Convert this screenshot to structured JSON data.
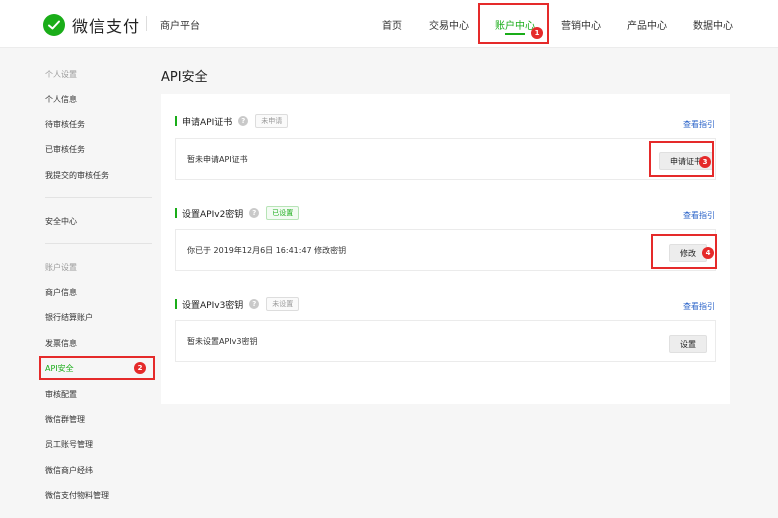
{
  "header": {
    "logo_text": "微信支付",
    "platform": "商户平台",
    "nav": [
      {
        "label": "首页"
      },
      {
        "label": "交易中心"
      },
      {
        "label": "账户中心"
      },
      {
        "label": "营销中心"
      },
      {
        "label": "产品中心"
      },
      {
        "label": "数据中心"
      }
    ],
    "active_nav_badge": "1"
  },
  "sidebar": {
    "group_personal": "个人设置",
    "personal_items": [
      {
        "label": "个人信息"
      },
      {
        "label": "待审核任务"
      },
      {
        "label": "已审核任务"
      },
      {
        "label": "我提交的审核任务"
      }
    ],
    "security_center": "安全中心",
    "group_account": "账户设置",
    "account_items": [
      {
        "label": "商户信息"
      },
      {
        "label": "银行结算账户"
      },
      {
        "label": "发票信息"
      },
      {
        "label": "API安全"
      },
      {
        "label": "审核配置"
      },
      {
        "label": "微信群管理"
      },
      {
        "label": "员工账号管理"
      },
      {
        "label": "微信商户经纬"
      },
      {
        "label": "微信支付物料管理"
      }
    ],
    "active_badge": "2"
  },
  "main": {
    "title": "API安全",
    "sections": [
      {
        "title": "申请API证书",
        "help": "?",
        "tag": "未申请",
        "guide": "查看指引",
        "content": "暂未申请API证书",
        "button": "申请证书",
        "badge": "3"
      },
      {
        "title": "设置APIv2密钥",
        "help": "?",
        "tag": "已设置",
        "guide": "查看指引",
        "content": "你已于 2019年12月6日 16:41:47 修改密钥",
        "button": "修改",
        "badge": "4"
      },
      {
        "title": "设置APIv3密钥",
        "help": "?",
        "tag": "未设置",
        "guide": "查看指引",
        "content": "暂未设置APIv3密钥",
        "button": "设置"
      }
    ]
  },
  "colors": {
    "brand_green": "#1aad19",
    "highlight_red": "#e52a2a",
    "link_blue": "#2a63c9"
  }
}
